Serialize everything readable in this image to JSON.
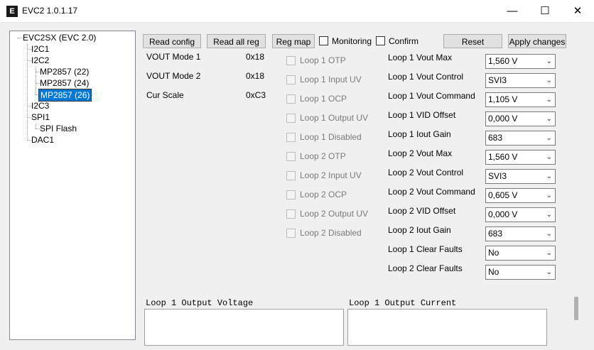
{
  "window": {
    "title": "EVC2 1.0.1.17",
    "minimize_glyph": "—",
    "maximize_glyph": "☐",
    "close_glyph": "✕",
    "icon_text": "E"
  },
  "tree": {
    "root": "EVC2SX (EVC 2.0)",
    "i2c1": "I2C1",
    "i2c2": "I2C2",
    "mp1": "MP2857 (22)",
    "mp2": "MP2857 (24)",
    "mp3": "MP2857 (26)",
    "i2c3": "I2C3",
    "spi1": "SPI1",
    "spiflash": "SPI Flash",
    "dac1": "DAC1"
  },
  "toolbar": {
    "read_config": "Read config",
    "read_all_reg": "Read all reg",
    "reg_map": "Reg map",
    "monitoring": "Monitoring",
    "confirm": "Confirm",
    "reset": "Reset",
    "apply_changes": "Apply changes"
  },
  "info": [
    {
      "label": "VOUT Mode 1",
      "value": "0x18"
    },
    {
      "label": "VOUT Mode 2",
      "value": "0x18"
    },
    {
      "label": "Cur Scale",
      "value": "0xC3"
    }
  ],
  "status_flags": [
    "Loop 1 OTP",
    "Loop 1 Input UV",
    "Loop 1 OCP",
    "Loop 1 Output UV",
    "Loop 1 Disabled",
    "Loop 2 OTP",
    "Loop 2 Input UV",
    "Loop 2 OCP",
    "Loop 2 Output UV",
    "Loop 2 Disabled"
  ],
  "params": [
    {
      "label": "Loop 1 Vout Max",
      "value": "1,560 V"
    },
    {
      "label": "Loop 1 Vout Control",
      "value": "SVI3"
    },
    {
      "label": "Loop 1 Vout Command",
      "value": "1,105 V"
    },
    {
      "label": "Loop 1 VID Offset",
      "value": "0,000 V"
    },
    {
      "label": "Loop 1 Iout Gain",
      "value": "683"
    },
    {
      "label": "Loop 2 Vout Max",
      "value": "1,560 V"
    },
    {
      "label": "Loop 2 Vout Control",
      "value": "SVI3"
    },
    {
      "label": "Loop 2 Vout Command",
      "value": "0,605 V"
    },
    {
      "label": "Loop 2 VID Offset",
      "value": "0,000 V"
    },
    {
      "label": "Loop 2 Iout Gain",
      "value": "683"
    },
    {
      "label": "Loop 1 Clear Faults",
      "value": "No"
    },
    {
      "label": "Loop 2 Clear Faults",
      "value": "No"
    }
  ],
  "combo_arrow_glyph": "⌄",
  "plots": {
    "voltage_title": "Loop 1 Output Voltage",
    "current_title": "Loop 1 Output Current"
  }
}
